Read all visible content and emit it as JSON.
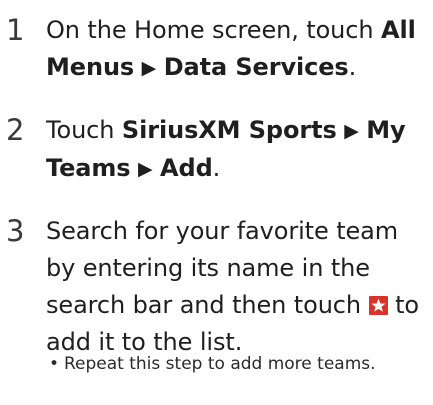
{
  "steps": [
    {
      "number": "1",
      "text_a": "On the Home screen, touch ",
      "bold_a": "All Menus",
      "arrow": "▶",
      "bold_b": "Data Services",
      "text_end": "."
    },
    {
      "number": "2",
      "text_a": "Touch ",
      "bold_a": "SiriusXM Sports",
      "arrow_a": "▶",
      "bold_b": "My Teams",
      "arrow_b": "▶",
      "bold_c": "Add",
      "text_end": "."
    },
    {
      "number": "3",
      "text_a": "Search for your favorite team by entering its name in the search bar and then touch ",
      "icon": "star-icon",
      "text_b": " to add it to the list."
    }
  ],
  "note": {
    "bullet": "•",
    "text": "Repeat this step to add more teams."
  },
  "colors": {
    "text": "#1f1f1f",
    "star_background": "#d9342b",
    "star": "#ffffff"
  }
}
